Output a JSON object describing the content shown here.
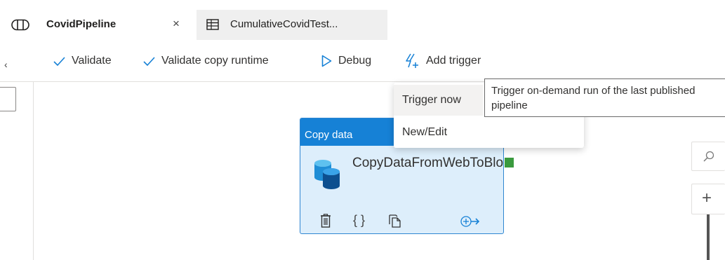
{
  "tabs": [
    {
      "label": "CovidPipeline",
      "icon": "pipeline-icon",
      "active": true
    },
    {
      "label": "CumulativeCovidTest...",
      "icon": "table-icon",
      "active": false
    }
  ],
  "tab_close_glyph": "×",
  "toolbar": {
    "validate_label": "Validate",
    "validate_copy_runtime_label": "Validate copy runtime",
    "debug_label": "Debug",
    "add_trigger_label": "Add trigger",
    "collapse_glyph": "‹"
  },
  "trigger_menu": {
    "items": [
      {
        "label": "Trigger now"
      },
      {
        "label": "New/Edit"
      }
    ]
  },
  "tooltip": {
    "text": "Trigger on-demand run of the last published pipeline"
  },
  "activity": {
    "type_label": "Copy data",
    "name": "CopyDataFromWebToBlob",
    "actions": [
      "delete-icon",
      "code-icon",
      "clone-icon",
      "add-output-icon"
    ]
  },
  "zoom": {
    "plus_glyph": "+"
  },
  "colors": {
    "accent": "#1681d6",
    "card_bg": "#ddeefb",
    "success": "#3a9a3e"
  }
}
